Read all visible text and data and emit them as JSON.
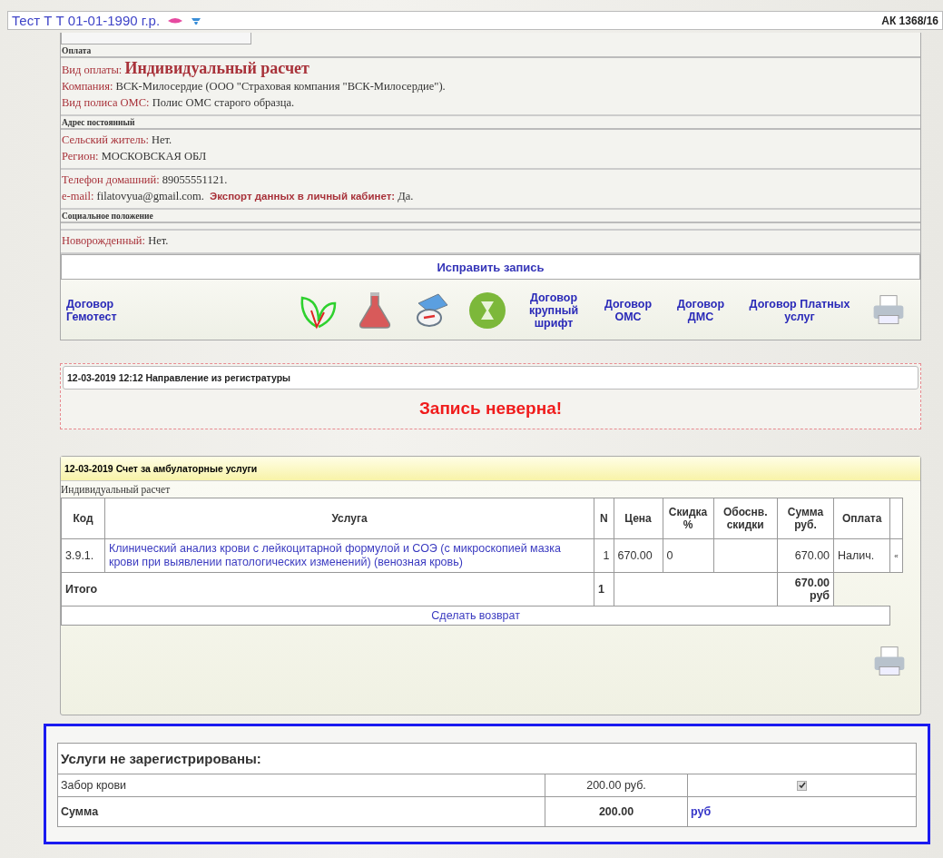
{
  "header": {
    "patient": "Тест Т Т 01-01-1990 г.р.",
    "card_number": "АК 1368/16"
  },
  "sections": [
    {
      "title": "Оплата",
      "rows": [
        [
          {
            "label": "Вид оплаты:",
            "value": "Индивидуальный расчет",
            "kind": "emphasis"
          }
        ],
        [
          {
            "label": "Компания:",
            "value": "ВСК-Милосердие (ООО \"Страховая компания \"ВСК-Милосердие\").",
            "kind": "plain"
          }
        ],
        [
          {
            "label": "Вид полиса ОМС:",
            "value": "Полис ОМС старого образца.",
            "kind": "plain"
          }
        ]
      ]
    },
    {
      "title": "Адрес постоянный",
      "rows": [
        [
          {
            "label": "Сельский житель:",
            "value": "Нет.",
            "kind": "plain"
          }
        ],
        [
          {
            "label": "Регион:",
            "value": "МОСКОВСКАЯ ОБЛ",
            "kind": "plain"
          }
        ]
      ]
    },
    {
      "rows": [
        [
          {
            "label": "Телефон домашний:",
            "value": "89055551121.",
            "kind": "plain"
          }
        ],
        [
          {
            "label": "e-mail:",
            "value": "filatovyua@gmail.com.",
            "kind": "plain"
          },
          {
            "label": "Экспорт данных в личный кабинет:",
            "value": "Да.",
            "kind": "strong"
          }
        ]
      ]
    },
    {
      "title": "Социальное положение"
    },
    {
      "rows": [
        [
          {
            "label": "Новорожденный:",
            "value": "Нет.",
            "kind": "plain"
          }
        ]
      ]
    }
  ],
  "edit_button": "Исправить запись",
  "toolbar": [
    {
      "kind": "link",
      "label": "Договор Гемотест"
    },
    {
      "kind": "leaf"
    },
    {
      "kind": "flask"
    },
    {
      "kind": "compass"
    },
    {
      "kind": "hourglass"
    },
    {
      "kind": "link",
      "label": "Договор крупный шрифт"
    },
    {
      "kind": "link",
      "label": "Договор ОМС"
    },
    {
      "kind": "link",
      "label": "Договор ДМС"
    },
    {
      "kind": "link",
      "label": "Договор Платных услуг"
    },
    {
      "kind": "printer"
    }
  ],
  "referral": {
    "title": "12-03-2019 12:12 Направление из регистратуры",
    "message": "Запись неверна!"
  },
  "invoice": {
    "title": "12-03-2019 Счет за амбулаторные услуги",
    "payment_type": "Индивидуальный расчет",
    "columns": [
      "Код",
      "Услуга",
      "N",
      "Цена",
      "Скидка %",
      "Обоснв. скидки",
      "Сумма руб.",
      "Оплата"
    ],
    "rows": [
      {
        "code": "3.9.1.",
        "service": "Клинический анализ крови с лейкоцитарной формулой и СОЭ (с микроскопией мазка крови при выявлении патологических изменений) (венозная кровь)",
        "n": "1",
        "price": "670.00",
        "discount": "0",
        "sum": "670.00",
        "payment": "Налич.",
        "mark": "«"
      }
    ],
    "total": {
      "label": "Итого",
      "n": "1",
      "sum": "670.00 руб"
    },
    "refund": "Сделать возврат"
  },
  "unregistered": {
    "title": "Услуги не зарегистрированы:",
    "items": [
      {
        "name": "Забор крови",
        "price": "200.00 руб.",
        "checked": true
      }
    ],
    "total": {
      "label": "Сумма",
      "value": "200.00",
      "currency": "руб"
    }
  }
}
